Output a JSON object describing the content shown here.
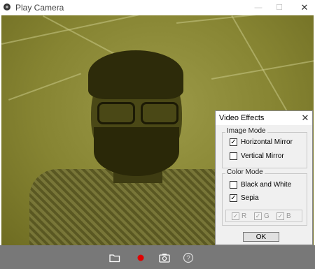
{
  "window": {
    "title": "Play Camera",
    "minimize_glyph": "—",
    "maximize_glyph": "☐",
    "close_glyph": "✕"
  },
  "toolbar": {
    "open_icon": "folder-open-icon",
    "record_icon": "record-icon",
    "snapshot_icon": "camera-icon",
    "help_icon": "help-icon",
    "record_color": "#e00000"
  },
  "dialog": {
    "title": "Video Effects",
    "close_glyph": "✕",
    "image_mode": {
      "label": "Image Mode",
      "horizontal_mirror": {
        "label": "Horizontal Mirror",
        "checked": true
      },
      "vertical_mirror": {
        "label": "Vertical Mirror",
        "checked": false
      }
    },
    "color_mode": {
      "label": "Color Mode",
      "black_and_white": {
        "label": "Black and White",
        "checked": false
      },
      "sepia": {
        "label": "Sepia",
        "checked": true
      },
      "channels": [
        {
          "label": "R",
          "checked": true
        },
        {
          "label": "G",
          "checked": true
        },
        {
          "label": "B",
          "checked": true
        }
      ]
    },
    "ok_label": "OK"
  },
  "colors": {
    "video_tint": "#8a8838",
    "toolbar_bg": "#787878"
  }
}
